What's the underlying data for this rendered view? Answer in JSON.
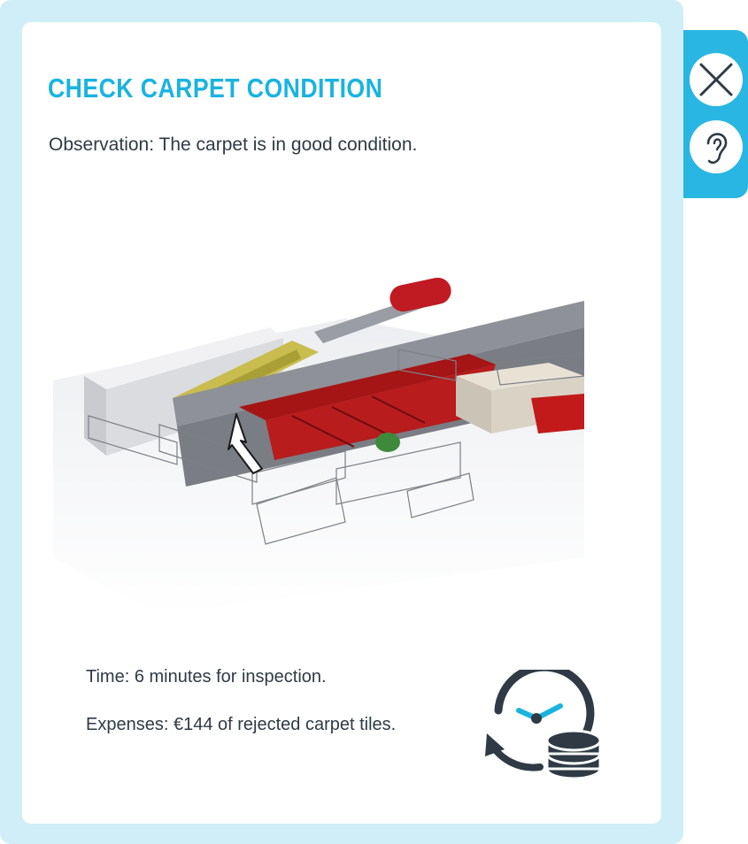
{
  "dialog": {
    "title": "CHECK CARPET CONDITION",
    "observation": "Observation: The carpet is in good condition.",
    "time": "Time:  6 minutes for inspection.",
    "expenses": "Expenses: €144 of rejected carpet tiles."
  },
  "side_controls": {
    "close_icon": "close-icon",
    "listen_icon": "ear-icon"
  },
  "colors": {
    "accent": "#1ab3e0",
    "frame": "#cfeef8",
    "tab": "#29b6e3",
    "carpet": "#b01818",
    "icon_dark": "#2f3a44"
  }
}
